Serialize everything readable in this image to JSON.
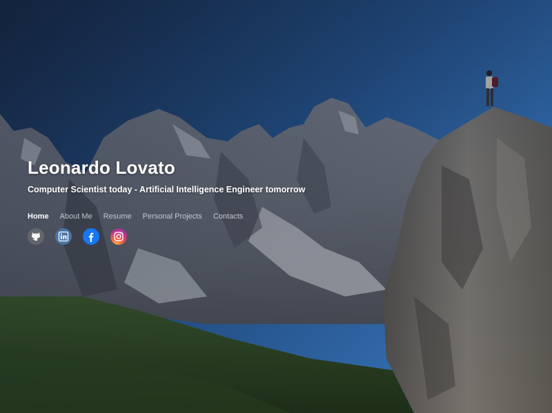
{
  "profile": {
    "name": "Leonardo Lovato",
    "subtitle": "Computer Scientist today - Artificial Intelligence Engineer tomorrow"
  },
  "nav": {
    "items": [
      {
        "label": "Home",
        "active": true
      },
      {
        "label": "About Me",
        "active": false
      },
      {
        "label": "Resume",
        "active": false
      },
      {
        "label": "Personal Projects",
        "active": false
      },
      {
        "label": "Contacts",
        "active": false
      }
    ]
  },
  "social": [
    {
      "icon": "github-icon",
      "color": "#7a7a7a"
    },
    {
      "icon": "linkedin-icon",
      "color": "#4c74a5"
    },
    {
      "icon": "facebook-icon",
      "color": "#1877f2"
    },
    {
      "icon": "instagram-icon",
      "color": "#c13584"
    }
  ],
  "colors": {
    "sky_top": "#1f3a63",
    "sky_bottom": "#3c7fd0",
    "text": "#ffffff",
    "nav_inactive": "#cfd5e0"
  }
}
